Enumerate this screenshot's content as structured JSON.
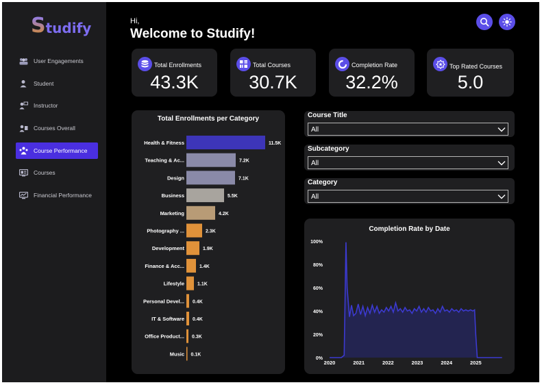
{
  "app": {
    "logo_first": "S",
    "logo_rest": "tudify"
  },
  "sidebar": {
    "items": [
      {
        "label": "User Engagements",
        "icon": "users-group-icon",
        "active": false
      },
      {
        "label": "Student",
        "icon": "student-icon",
        "active": false
      },
      {
        "label": "Instructor",
        "icon": "instructor-icon",
        "active": false
      },
      {
        "label": "Courses Overall",
        "icon": "courses-overall-icon",
        "active": false
      },
      {
        "label": "Course Performance",
        "icon": "course-performance-icon",
        "active": true
      },
      {
        "label": "Courses",
        "icon": "courses-icon",
        "active": false
      },
      {
        "label": "Financial Performance",
        "icon": "financial-icon",
        "active": false
      }
    ]
  },
  "header": {
    "greeting": "Hi,",
    "title": "Welcome to Studify!",
    "search_icon": "search-icon",
    "theme_icon": "sun-icon"
  },
  "kpis": [
    {
      "label": "Total Enrollments",
      "value": "43.3K",
      "icon": "database-icon"
    },
    {
      "label": "Total Courses",
      "value": "30.7K",
      "icon": "courses-grid-icon"
    },
    {
      "label": "Completion Rate",
      "value": "32.2%",
      "icon": "progress-ring-icon"
    },
    {
      "label": "Top Rated Courses",
      "value": "5.0",
      "icon": "badge-star-icon"
    }
  ],
  "filters": [
    {
      "label": "Course Title",
      "value": "All"
    },
    {
      "label": "Subcategory",
      "value": "All"
    },
    {
      "label": "Category",
      "value": "All"
    }
  ],
  "colors": {
    "accent": "#5b4ee8",
    "active_nav": "#4a2fe0",
    "panel": "#1f1f21",
    "sidebar": "#1c1c1e",
    "line": "#3c3ad0",
    "area": "#232450"
  },
  "chart_data": [
    {
      "type": "bar",
      "orientation": "horizontal",
      "title": "Total Enrollments per Category",
      "categories": [
        "Health & Fitness",
        "Teaching & Ac...",
        "Design",
        "Business",
        "Marketing",
        "Photography ...",
        "Development",
        "Finance & Acc...",
        "Lifestyle",
        "Personal Devel...",
        "IT & Software",
        "Office Product...",
        "Music"
      ],
      "values": [
        11.5,
        7.2,
        7.1,
        5.5,
        4.2,
        2.3,
        1.9,
        1.4,
        1.1,
        0.4,
        0.4,
        0.3,
        0.1
      ],
      "data_labels": [
        "11.5K",
        "7.2K",
        "7.1K",
        "5.5K",
        "4.2K",
        "2.3K",
        "1.9K",
        "1.4K",
        "1.1K",
        "0.4K",
        "0.4K",
        "0.3K",
        "0.1K"
      ],
      "unit": "K",
      "bar_colors": [
        "#3d35b8",
        "#8a8aa8",
        "#8a8aa8",
        "#a8a49e",
        "#b89b76",
        "#e0923a",
        "#e0923a",
        "#e0923a",
        "#e0923a",
        "#e0923a",
        "#e0923a",
        "#e0923a",
        "#e0923a"
      ]
    },
    {
      "type": "area",
      "title": "Completion Rate by Date",
      "xlim": [
        2020,
        2026
      ],
      "ylim": [
        0,
        100
      ],
      "yticks": [
        "0%",
        "20%",
        "40%",
        "60%",
        "80%",
        "100%"
      ],
      "ytick_values": [
        0,
        20,
        40,
        60,
        80,
        100
      ],
      "xticks": [
        "2020",
        "2021",
        "2022",
        "2023",
        "2024",
        "2025"
      ],
      "xtick_values": [
        2020,
        2021,
        2022,
        2023,
        2024,
        2025
      ],
      "points": [
        [
          2020,
          0
        ],
        [
          2020.4,
          0
        ],
        [
          2020.5,
          2
        ],
        [
          2020.56,
          99
        ],
        [
          2020.6,
          60
        ],
        [
          2020.68,
          35
        ],
        [
          2020.75,
          45
        ],
        [
          2020.82,
          36
        ],
        [
          2020.9,
          38
        ],
        [
          2020.98,
          46
        ],
        [
          2021.06,
          37
        ],
        [
          2021.14,
          44
        ],
        [
          2021.22,
          36
        ],
        [
          2021.3,
          43
        ],
        [
          2021.38,
          38
        ],
        [
          2021.46,
          45
        ],
        [
          2021.54,
          39
        ],
        [
          2021.62,
          44
        ],
        [
          2021.7,
          38
        ],
        [
          2021.78,
          41
        ],
        [
          2021.86,
          39
        ],
        [
          2021.94,
          43
        ],
        [
          2022.02,
          40
        ],
        [
          2022.1,
          44
        ],
        [
          2022.18,
          39
        ],
        [
          2022.26,
          47
        ],
        [
          2022.34,
          40
        ],
        [
          2022.42,
          42
        ],
        [
          2022.5,
          39
        ],
        [
          2022.58,
          43
        ],
        [
          2022.66,
          40
        ],
        [
          2022.74,
          41
        ],
        [
          2022.82,
          38
        ],
        [
          2022.9,
          42
        ],
        [
          2022.98,
          40
        ],
        [
          2023.06,
          44
        ],
        [
          2023.14,
          39
        ],
        [
          2023.22,
          42
        ],
        [
          2023.3,
          39
        ],
        [
          2023.38,
          43
        ],
        [
          2023.46,
          40
        ],
        [
          2023.54,
          41
        ],
        [
          2023.62,
          38
        ],
        [
          2023.7,
          42
        ],
        [
          2023.78,
          39
        ],
        [
          2023.86,
          44
        ],
        [
          2023.94,
          40
        ],
        [
          2024.02,
          41
        ],
        [
          2024.1,
          39
        ],
        [
          2024.18,
          42
        ],
        [
          2024.26,
          40
        ],
        [
          2024.34,
          41
        ],
        [
          2024.42,
          39
        ],
        [
          2024.5,
          42
        ],
        [
          2024.58,
          40
        ],
        [
          2024.66,
          41
        ],
        [
          2024.74,
          40
        ],
        [
          2024.82,
          41
        ],
        [
          2024.9,
          40
        ],
        [
          2024.96,
          41
        ],
        [
          2025.0,
          20
        ],
        [
          2025.05,
          0
        ],
        [
          2025.9,
          0
        ]
      ]
    }
  ]
}
